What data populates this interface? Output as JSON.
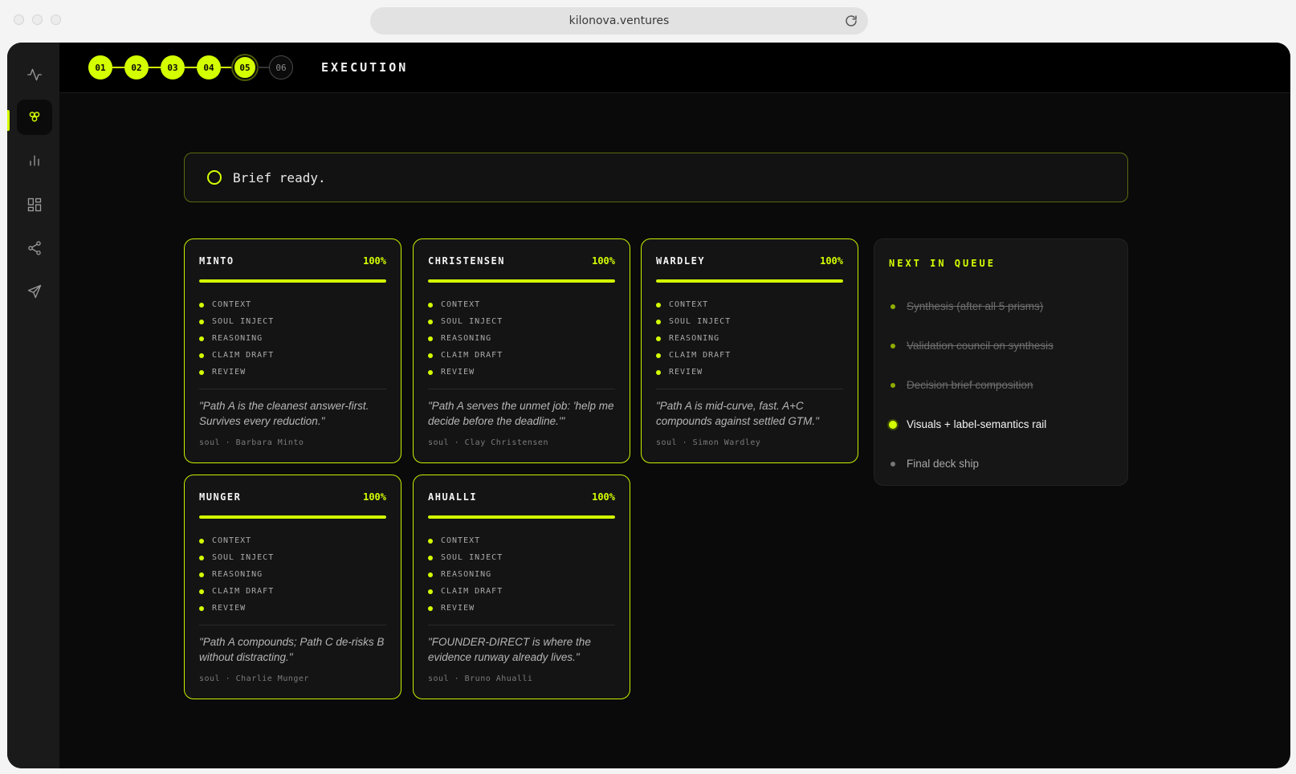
{
  "browser": {
    "url": "kilonova.ventures"
  },
  "sidebar": {
    "items": [
      {
        "icon": "activity-icon",
        "active": false
      },
      {
        "icon": "prism-icon",
        "active": true
      },
      {
        "icon": "bar-chart-icon",
        "active": false
      },
      {
        "icon": "grid-icon",
        "active": false
      },
      {
        "icon": "share-icon",
        "active": false
      },
      {
        "icon": "send-icon",
        "active": false
      }
    ]
  },
  "header": {
    "steps": [
      {
        "label": "01",
        "state": "done"
      },
      {
        "label": "02",
        "state": "done"
      },
      {
        "label": "03",
        "state": "done"
      },
      {
        "label": "04",
        "state": "done"
      },
      {
        "label": "05",
        "state": "current"
      },
      {
        "label": "06",
        "state": "pending"
      }
    ],
    "phase_title": "EXECUTION"
  },
  "brief": {
    "text": "Brief ready."
  },
  "colors": {
    "accent": "#d4ff00",
    "background": "#0a0a0a",
    "card": "#141414"
  },
  "cards": [
    {
      "name": "MINTO",
      "percent": "100%",
      "progress": 1.0,
      "stages": [
        "CONTEXT",
        "SOUL INJECT",
        "REASONING",
        "CLAIM DRAFT",
        "REVIEW"
      ],
      "quote": "\"Path A is the cleanest answer-first. Survives every reduction.\"",
      "soul": "soul · Barbara Minto"
    },
    {
      "name": "CHRISTENSEN",
      "percent": "100%",
      "progress": 1.0,
      "stages": [
        "CONTEXT",
        "SOUL INJECT",
        "REASONING",
        "CLAIM DRAFT",
        "REVIEW"
      ],
      "quote": "\"Path A serves the unmet job: 'help me decide before the deadline.'\"",
      "soul": "soul · Clay Christensen"
    },
    {
      "name": "WARDLEY",
      "percent": "100%",
      "progress": 1.0,
      "stages": [
        "CONTEXT",
        "SOUL INJECT",
        "REASONING",
        "CLAIM DRAFT",
        "REVIEW"
      ],
      "quote": "\"Path A is mid-curve, fast. A+C compounds against settled GTM.\"",
      "soul": "soul · Simon Wardley"
    },
    {
      "name": "MUNGER",
      "percent": "100%",
      "progress": 1.0,
      "stages": [
        "CONTEXT",
        "SOUL INJECT",
        "REASONING",
        "CLAIM DRAFT",
        "REVIEW"
      ],
      "quote": "\"Path A compounds; Path C de-risks B without distracting.\"",
      "soul": "soul · Charlie Munger"
    },
    {
      "name": "AHUALLI",
      "percent": "100%",
      "progress": 1.0,
      "stages": [
        "CONTEXT",
        "SOUL INJECT",
        "REASONING",
        "CLAIM DRAFT",
        "REVIEW"
      ],
      "quote": "\"FOUNDER-DIRECT is where the evidence runway already lives.\"",
      "soul": "soul · Bruno Ahualli"
    }
  ],
  "queue": {
    "title": "NEXT IN QUEUE",
    "items": [
      {
        "label": "Synthesis (after all 5 prisms)",
        "state": "done"
      },
      {
        "label": "Validation council on synthesis",
        "state": "done"
      },
      {
        "label": "Decision brief composition",
        "state": "done"
      },
      {
        "label": "Visuals + label-semantics rail",
        "state": "current"
      },
      {
        "label": "Final deck ship",
        "state": "pending"
      }
    ]
  }
}
